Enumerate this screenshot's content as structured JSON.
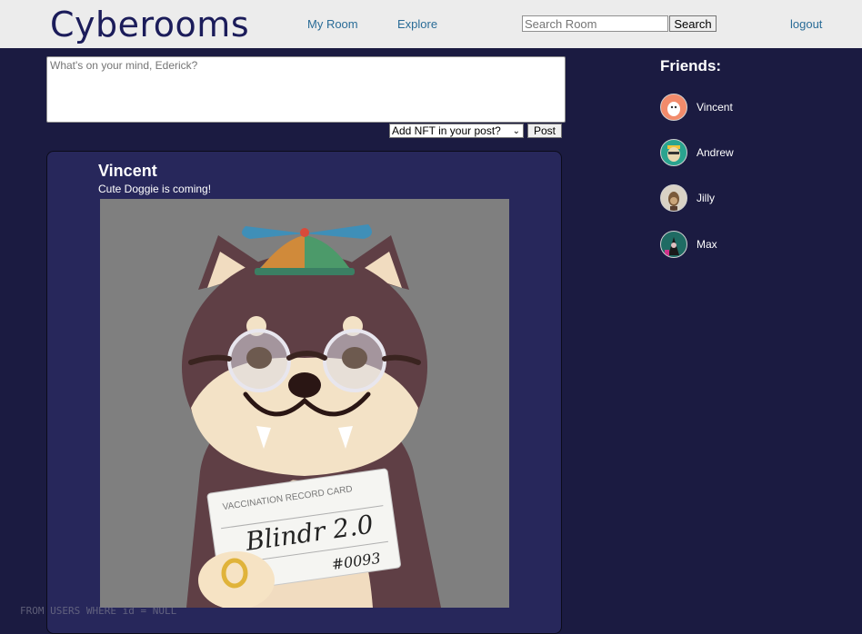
{
  "header": {
    "logo": "Cyberooms",
    "nav": {
      "my_room": "My Room",
      "explore": "Explore",
      "logout": "logout"
    },
    "search": {
      "placeholder": "Search Room",
      "button": "Search"
    }
  },
  "composer": {
    "placeholder": "What's on your mind, Ederick?",
    "nft_select_value": "Add NFT in your post?",
    "post_button": "Post"
  },
  "feed": {
    "posts": [
      {
        "author": "Vincent",
        "text": "Cute Doggie is coming!",
        "image": {
          "card_header": "VACCINATION RECORD CARD",
          "card_name": "Blindr 2.0",
          "card_number": "#0093"
        }
      }
    ]
  },
  "friends": {
    "title": "Friends:",
    "items": [
      {
        "name": "Vincent",
        "avatar_color": "#f28b6b"
      },
      {
        "name": "Andrew",
        "avatar_color": "#2aa38f"
      },
      {
        "name": "Jilly",
        "avatar_color": "#d9d2c5"
      },
      {
        "name": "Max",
        "avatar_color": "#1f6b63"
      }
    ]
  },
  "footer_overlay_text": "FROM USERS WHERE id = NULL"
}
